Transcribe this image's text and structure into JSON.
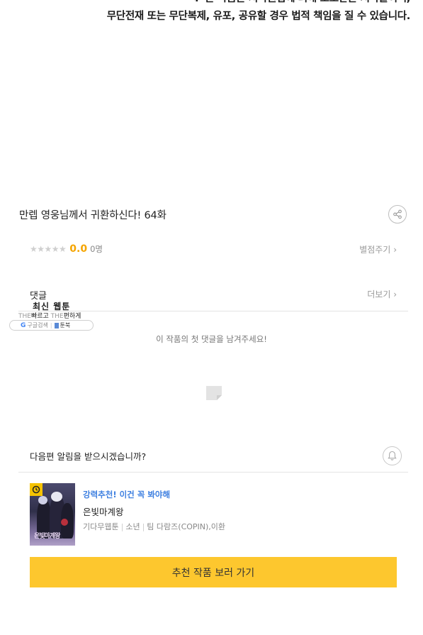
{
  "notice": {
    "line1": "※ 본 작품은 저작권법에 의해 보호받는 저작물이며,",
    "line2": "무단전재 또는 무단복제, 유포, 공유할 경우 법적 책임을 질 수 있습니다."
  },
  "episode": {
    "title": "만렙 영웅님께서 귀환하신다! 64화",
    "share_icon": "share-icon"
  },
  "rating": {
    "stars": "★★★★★",
    "score": "0.0",
    "count": "0명",
    "give_label": "별점주기",
    "give_chevron": "›"
  },
  "comments": {
    "label": "댓글",
    "more_label": "더보기",
    "more_chevron": "›",
    "empty_message": "이 작품의 첫 댓글을 남겨주세요!",
    "empty_icon": "memo-icon"
  },
  "ad": {
    "title": "최신 웹툰",
    "the1": "THE",
    "fast": "빠르고",
    "the2": "THE",
    "easy": "편하게",
    "search_g": "G",
    "search_label": "구글검색",
    "brand": "툰북"
  },
  "alarm": {
    "question": "다음편 알림을 받으시겠습니까?",
    "icon": "bell-icon"
  },
  "recommendation": {
    "tag": "강력추천! 이건 꼭 봐야해",
    "title": "은빛마계왕",
    "meta_type": "기다무웹툰",
    "meta_genre": "소년",
    "meta_authors": "팀 다람즈(COPIN),이환",
    "thumb_badge_icon": "clock-icon",
    "thumb_logo": "은빛마계왕",
    "button_label": "추천 작품 보러 가기"
  },
  "colors": {
    "accent_yellow": "#fdc72e",
    "score_orange": "#f5a500",
    "tag_blue": "#3d7fe0"
  }
}
